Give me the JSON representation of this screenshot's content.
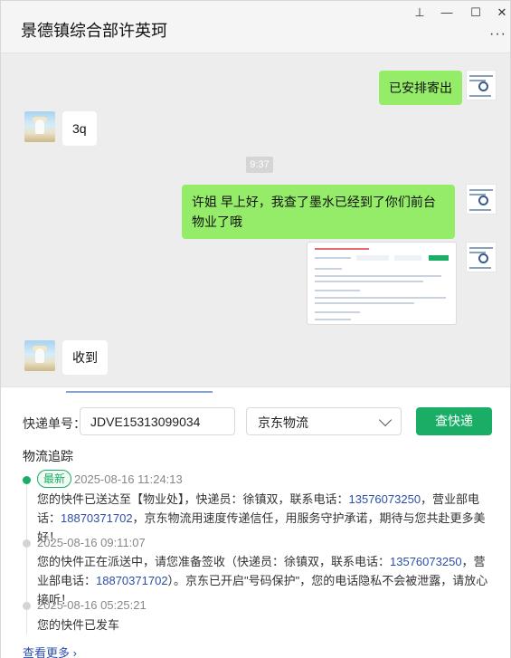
{
  "window": {
    "title": "景德镇综合部许英珂",
    "controls": {
      "pin": "⊥",
      "minimize": "—",
      "maximize": "☐",
      "close": "✕",
      "more": "···"
    }
  },
  "chat": {
    "messages": [
      {
        "side": "right",
        "type": "text",
        "text": "已安排寄出"
      },
      {
        "side": "left",
        "type": "text",
        "text": "3q"
      },
      {
        "side": "center",
        "type": "time",
        "text": "9:37"
      },
      {
        "side": "right",
        "type": "text",
        "text": "许姐 早上好，我查了墨水已经到了你们前台物业了哦"
      },
      {
        "side": "right",
        "type": "image",
        "text": ""
      },
      {
        "side": "left",
        "type": "text",
        "text": "收到"
      }
    ]
  },
  "tracking": {
    "label_no": "快递单号：",
    "tracking_no": "JDVE15313099034",
    "carrier": "京东物流",
    "query_button": "查快递",
    "section_title": "物流追踪",
    "events": [
      {
        "badge": "最新",
        "time": "2025-08-16 11:24:13",
        "text_parts": [
          "您的快件已送达至【物业处】，快递员：徐镇双，联系电话：",
          "13576073250",
          "，营业部电话：",
          "18870371702",
          "，京东物流用速度传递信任，用服务守护承诺，期待与您共赴更多美好！"
        ]
      },
      {
        "badge": "",
        "time": "2025-08-16 09:11:07",
        "text_parts": [
          "您的快件正在派送中，请您准备签收（快递员：徐镇双，联系电话：",
          "13576073250",
          "，营业部电话：",
          "18870371702",
          "）。京东已开启\"号码保护\"，您的电话隐私不会被泄露，请放心接听！"
        ]
      },
      {
        "badge": "",
        "time": "2025-08-16 05:25:21",
        "text_parts": [
          "您的快件已发车"
        ]
      }
    ],
    "more_link": "查看更多 ›"
  },
  "colors": {
    "accent_green": "#1aad65",
    "bubble_green": "#95ec69",
    "link_blue": "#2b4fa8"
  }
}
